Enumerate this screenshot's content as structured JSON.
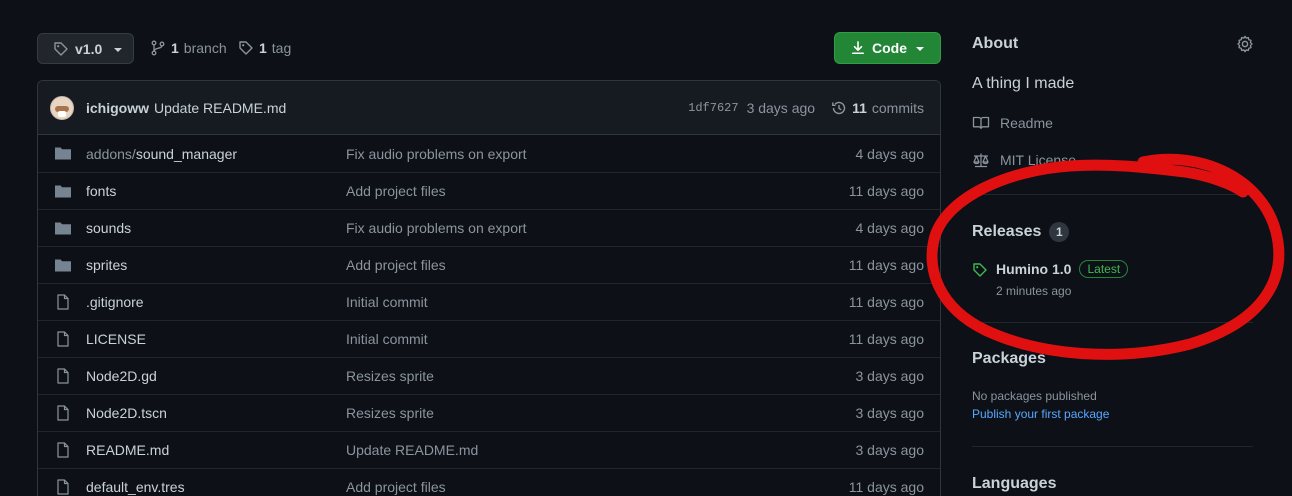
{
  "toolbar": {
    "branch_label": "v1.0",
    "branches_count": "1",
    "branches_text": "branch",
    "tags_count": "1",
    "tags_text": "tag",
    "code_label": "Code"
  },
  "commit": {
    "user": "ichigoww",
    "message": "Update README.md",
    "sha": "1df7627",
    "age": "3 days ago",
    "commits_count": "11",
    "commits_text": "commits"
  },
  "files": [
    {
      "type": "folder",
      "name_prefix": "addons/",
      "name": "sound_manager",
      "message": "Fix audio problems on export",
      "age": "4 days ago"
    },
    {
      "type": "folder",
      "name_prefix": "",
      "name": "fonts",
      "message": "Add project files",
      "age": "11 days ago"
    },
    {
      "type": "folder",
      "name_prefix": "",
      "name": "sounds",
      "message": "Fix audio problems on export",
      "age": "4 days ago"
    },
    {
      "type": "folder",
      "name_prefix": "",
      "name": "sprites",
      "message": "Add project files",
      "age": "11 days ago"
    },
    {
      "type": "file",
      "name_prefix": "",
      "name": ".gitignore",
      "message": "Initial commit",
      "age": "11 days ago"
    },
    {
      "type": "file",
      "name_prefix": "",
      "name": "LICENSE",
      "message": "Initial commit",
      "age": "11 days ago"
    },
    {
      "type": "file",
      "name_prefix": "",
      "name": "Node2D.gd",
      "message": "Resizes sprite",
      "age": "3 days ago"
    },
    {
      "type": "file",
      "name_prefix": "",
      "name": "Node2D.tscn",
      "message": "Resizes sprite",
      "age": "3 days ago"
    },
    {
      "type": "file",
      "name_prefix": "",
      "name": "README.md",
      "message": "Update README.md",
      "age": "3 days ago"
    },
    {
      "type": "file",
      "name_prefix": "",
      "name": "default_env.tres",
      "message": "Add project files",
      "age": "11 days ago"
    }
  ],
  "sidebar": {
    "about_title": "About",
    "description": "A thing I made",
    "readme_label": "Readme",
    "license_label": "MIT License",
    "releases_title": "Releases",
    "releases_count": "1",
    "release_name": "Humino 1.0",
    "release_badge": "Latest",
    "release_time": "2 minutes ago",
    "packages_title": "Packages",
    "packages_empty": "No packages published",
    "packages_link": "Publish your first package",
    "languages_title": "Languages"
  },
  "colors": {
    "background": "#0d1117",
    "accent_green": "#238636",
    "link_blue": "#58a6ff",
    "annotation_red": "#e01010"
  },
  "icons": {
    "folder": "folder-icon",
    "file": "file-icon",
    "tag": "tag-icon",
    "branch": "git-branch-icon",
    "history": "history-icon",
    "book": "book-icon",
    "law": "law-icon",
    "gear": "gear-icon",
    "download": "download-icon"
  }
}
